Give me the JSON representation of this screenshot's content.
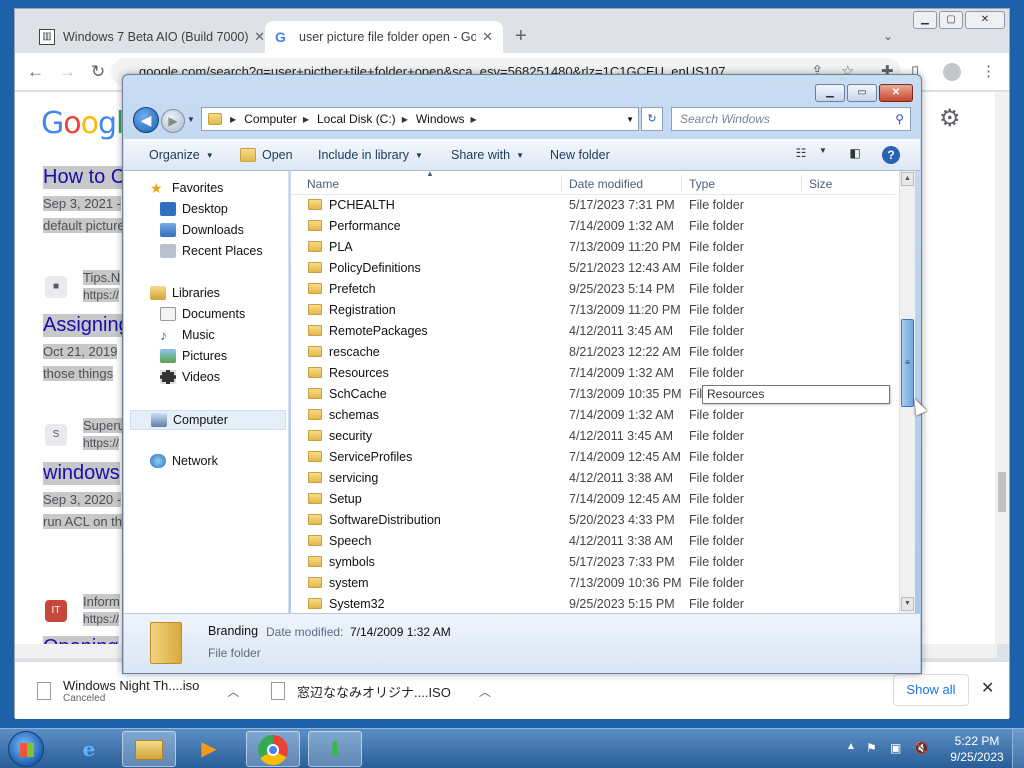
{
  "browser": {
    "tabs": [
      {
        "title": "Windows 7 Beta AIO (Build 7000)",
        "active": false
      },
      {
        "title": "user picture file folder open - Go",
        "active": true
      }
    ],
    "new_tab_label": "+",
    "address": "google.com/search?q=user+picther+tile+folder+open&sca_esv=568251480&rlz=1C1GCEU_enUS107",
    "logo_text": "Google",
    "results": [
      {
        "title": "How to C",
        "snippet_line1": "Sep 3, 2021 -",
        "snippet_line2": "default picture"
      },
      {
        "source": "Tips.N",
        "url": "https://",
        "title": "Assigning",
        "snippet_line1": "Oct 21, 2019",
        "snippet_line2": "those things"
      },
      {
        "source": "Superu",
        "url": "https://",
        "title": "windows",
        "snippet_line1": "Sep 3, 2020 -",
        "snippet_line2": "run ACL on th"
      },
      {
        "source": "Inform",
        "url": "https://",
        "title": "Opening"
      }
    ],
    "downloads": [
      {
        "name": "Windows Night Th....iso",
        "status": "Canceled"
      },
      {
        "name": "窓辺ななみオリジナ....ISO",
        "status": ""
      }
    ],
    "show_all_label": "Show all",
    "close_label": "✕"
  },
  "explorer": {
    "address": {
      "crumbs": [
        "Computer",
        "Local Disk (C:)",
        "Windows"
      ]
    },
    "search_placeholder": "Search Windows",
    "commands": {
      "organize": "Organize",
      "open": "Open",
      "include_in_library": "Include in library",
      "share_with": "Share with",
      "new_folder": "New folder"
    },
    "nav": {
      "favorites": "Favorites",
      "desktop": "Desktop",
      "downloads": "Downloads",
      "recent_places": "Recent Places",
      "libraries": "Libraries",
      "documents": "Documents",
      "music": "Music",
      "pictures": "Pictures",
      "videos": "Videos",
      "computer": "Computer",
      "network": "Network"
    },
    "columns": {
      "name": "Name",
      "date": "Date modified",
      "type": "Type",
      "size": "Size"
    },
    "rows": [
      {
        "name": "PCHEALTH",
        "date": "5/17/2023 7:31 PM",
        "type": "File folder"
      },
      {
        "name": "Performance",
        "date": "7/14/2009 1:32 AM",
        "type": "File folder"
      },
      {
        "name": "PLA",
        "date": "7/13/2009 11:20 PM",
        "type": "File folder"
      },
      {
        "name": "PolicyDefinitions",
        "date": "5/21/2023 12:43 AM",
        "type": "File folder"
      },
      {
        "name": "Prefetch",
        "date": "9/25/2023 5:14 PM",
        "type": "File folder"
      },
      {
        "name": "Registration",
        "date": "7/13/2009 11:20 PM",
        "type": "File folder"
      },
      {
        "name": "RemotePackages",
        "date": "4/12/2011 3:45 AM",
        "type": "File folder"
      },
      {
        "name": "rescache",
        "date": "8/21/2023 12:22 AM",
        "type": "File folder"
      },
      {
        "name": "Resources",
        "date": "7/14/2009 1:32 AM",
        "type": "File folder"
      },
      {
        "name": "SchCache",
        "date": "7/13/2009 10:35 PM",
        "type": "File folder"
      },
      {
        "name": "schemas",
        "date": "7/14/2009 1:32 AM",
        "type": "File folder"
      },
      {
        "name": "security",
        "date": "4/12/2011 3:45 AM",
        "type": "File folder"
      },
      {
        "name": "ServiceProfiles",
        "date": "7/14/2009 12:45 AM",
        "type": "File folder"
      },
      {
        "name": "servicing",
        "date": "4/12/2011 3:38 AM",
        "type": "File folder"
      },
      {
        "name": "Setup",
        "date": "7/14/2009 12:45 AM",
        "type": "File folder"
      },
      {
        "name": "SoftwareDistribution",
        "date": "5/20/2023 4:33 PM",
        "type": "File folder"
      },
      {
        "name": "Speech",
        "date": "4/12/2011 3:38 AM",
        "type": "File folder"
      },
      {
        "name": "symbols",
        "date": "5/17/2023 7:33 PM",
        "type": "File folder"
      },
      {
        "name": "system",
        "date": "7/13/2009 10:36 PM",
        "type": "File folder"
      },
      {
        "name": "System32",
        "date": "9/25/2023 5:15 PM",
        "type": "File folder"
      }
    ],
    "tooltip": "Resources",
    "details": {
      "name": "Branding",
      "date_label": "Date modified:",
      "date_value": "7/14/2009 1:32 AM",
      "type": "File folder"
    }
  },
  "taskbar": {
    "clock_time": "5:22 PM",
    "clock_date": "9/25/2023"
  }
}
